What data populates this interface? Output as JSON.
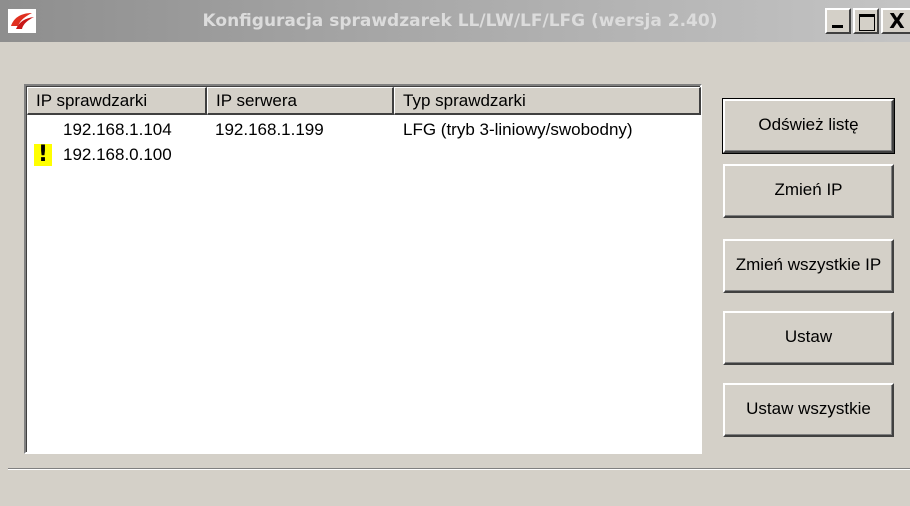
{
  "window": {
    "title": "Konfiguracja sprawdzarek LL/LW/LF/LFG (wersja 2.40)",
    "controls": {
      "close_glyph": "X"
    },
    "icons": {
      "app": "red-logo-icon",
      "warning": "exclamation-icon"
    },
    "colors": {
      "warning_background": "#ffff00",
      "face": "#d4d0c8"
    }
  },
  "list": {
    "columns": [
      "IP sprawdzarki",
      "IP serwera",
      "Typ sprawdzarki"
    ],
    "rows": [
      {
        "warning": "",
        "ip": "192.168.1.104",
        "server": "192.168.1.199",
        "type": "LFG (tryb 3-liniowy/swobodny)"
      },
      {
        "warning": "!",
        "ip": "192.168.0.100",
        "server": "",
        "type": ""
      }
    ]
  },
  "buttons": {
    "refresh": "Odśwież listę",
    "change_ip": "Zmień IP",
    "change_all_ip": "Zmień wszystkie IP",
    "set": "Ustaw",
    "set_all": "Ustaw wszystkie"
  }
}
